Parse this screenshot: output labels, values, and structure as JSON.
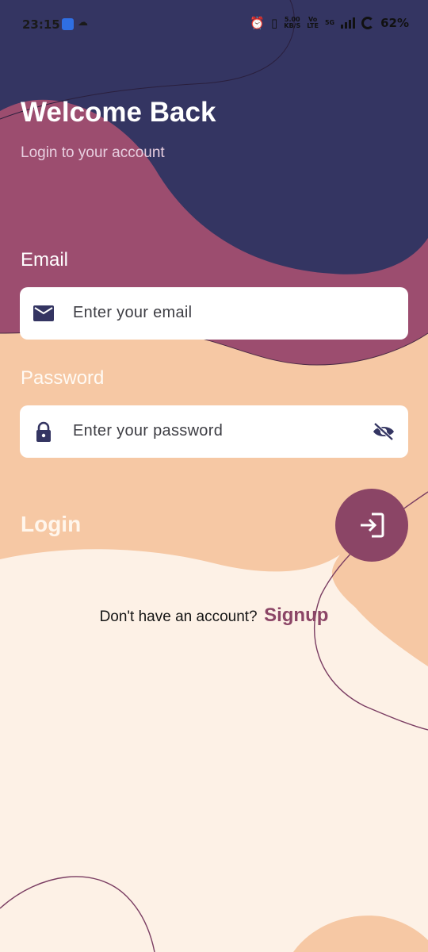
{
  "status_bar": {
    "time": "23:15",
    "speed_value": "5.00",
    "speed_unit": "KB/S",
    "volte_top": "Vo",
    "volte_bottom": "LTE",
    "network": "5G",
    "battery": "62%"
  },
  "header": {
    "title": "Welcome Back",
    "subtitle": "Login to your account"
  },
  "form": {
    "email_label": "Email",
    "email_placeholder": "Enter your email",
    "password_label": "Password",
    "password_placeholder": "Enter your password"
  },
  "login": {
    "label": "Login"
  },
  "signup": {
    "question": "Don't have an account?",
    "link": "Signup"
  },
  "colors": {
    "navy": "#343562",
    "plum": "#9c4d6f",
    "peach": "#f6c8a4",
    "cream": "#fdf1e6",
    "button": "#8b4566"
  },
  "icons": {
    "email": "mail-icon",
    "password": "lock-icon",
    "visibility": "eye-off-icon",
    "login": "login-arrow-icon"
  }
}
